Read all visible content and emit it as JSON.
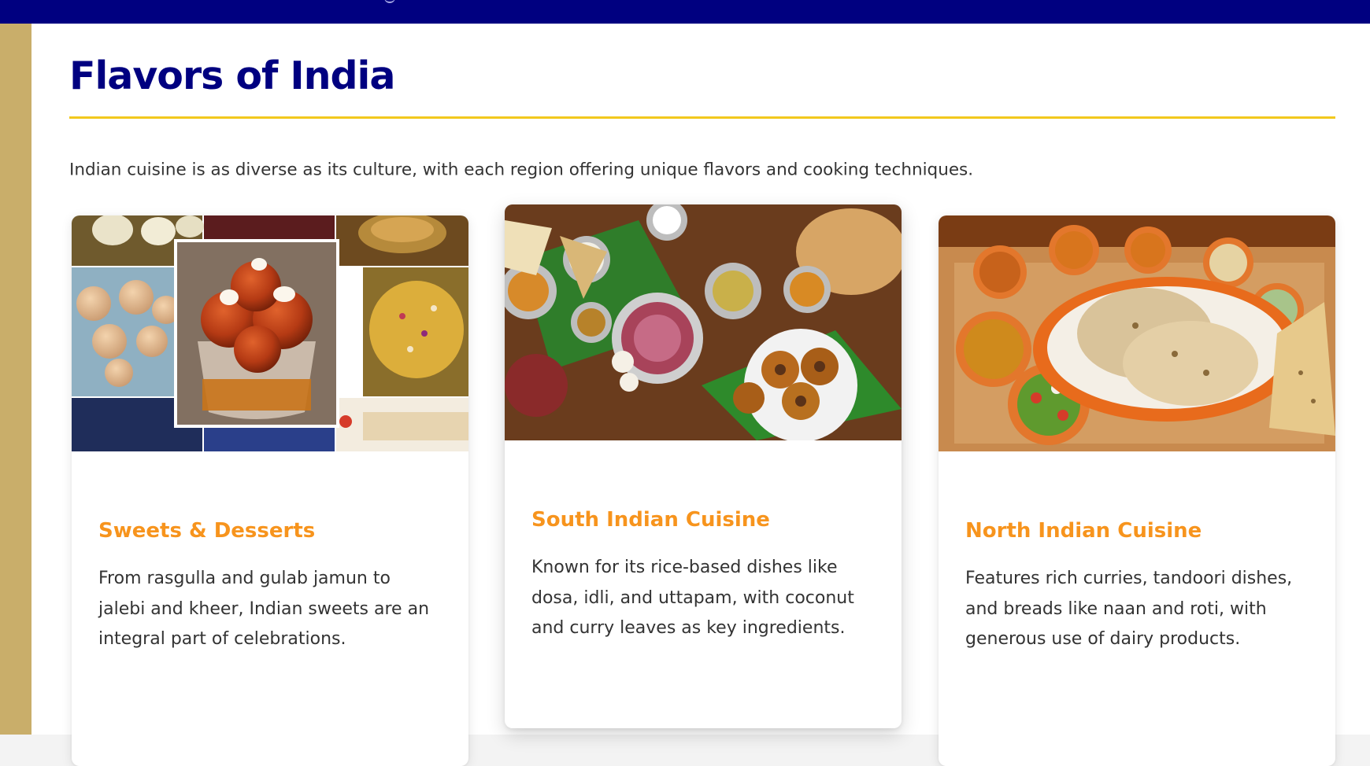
{
  "page": {
    "title": "Flavors of India",
    "intro": "Indian cuisine is as diverse as its culture, with each region offering unique flavors and cooking techniques."
  },
  "colors": {
    "topbar": "#000080",
    "sidebar_stripe": "#c9ae6a",
    "title": "#000080",
    "title_rule": "#f2c81d",
    "card_title": "#f7941d",
    "body_text": "#333333"
  },
  "cards": [
    {
      "image_subject": "indian-sweets-collage",
      "title": "Sweets & Desserts",
      "description": "From rasgulla and gulab jamun to jalebi and kheer, Indian sweets are an integral part of celebrations."
    },
    {
      "image_subject": "south-indian-platter",
      "title": "South Indian Cuisine",
      "description": "Known for its rice-based dishes like dosa, idli, and uttapam, with coconut and curry leaves as key ingredients."
    },
    {
      "image_subject": "north-indian-thali",
      "title": "North Indian Cuisine",
      "description": "Features rich curries, tandoori dishes, and breads like naan and roti, with generous use of dairy products."
    }
  ]
}
